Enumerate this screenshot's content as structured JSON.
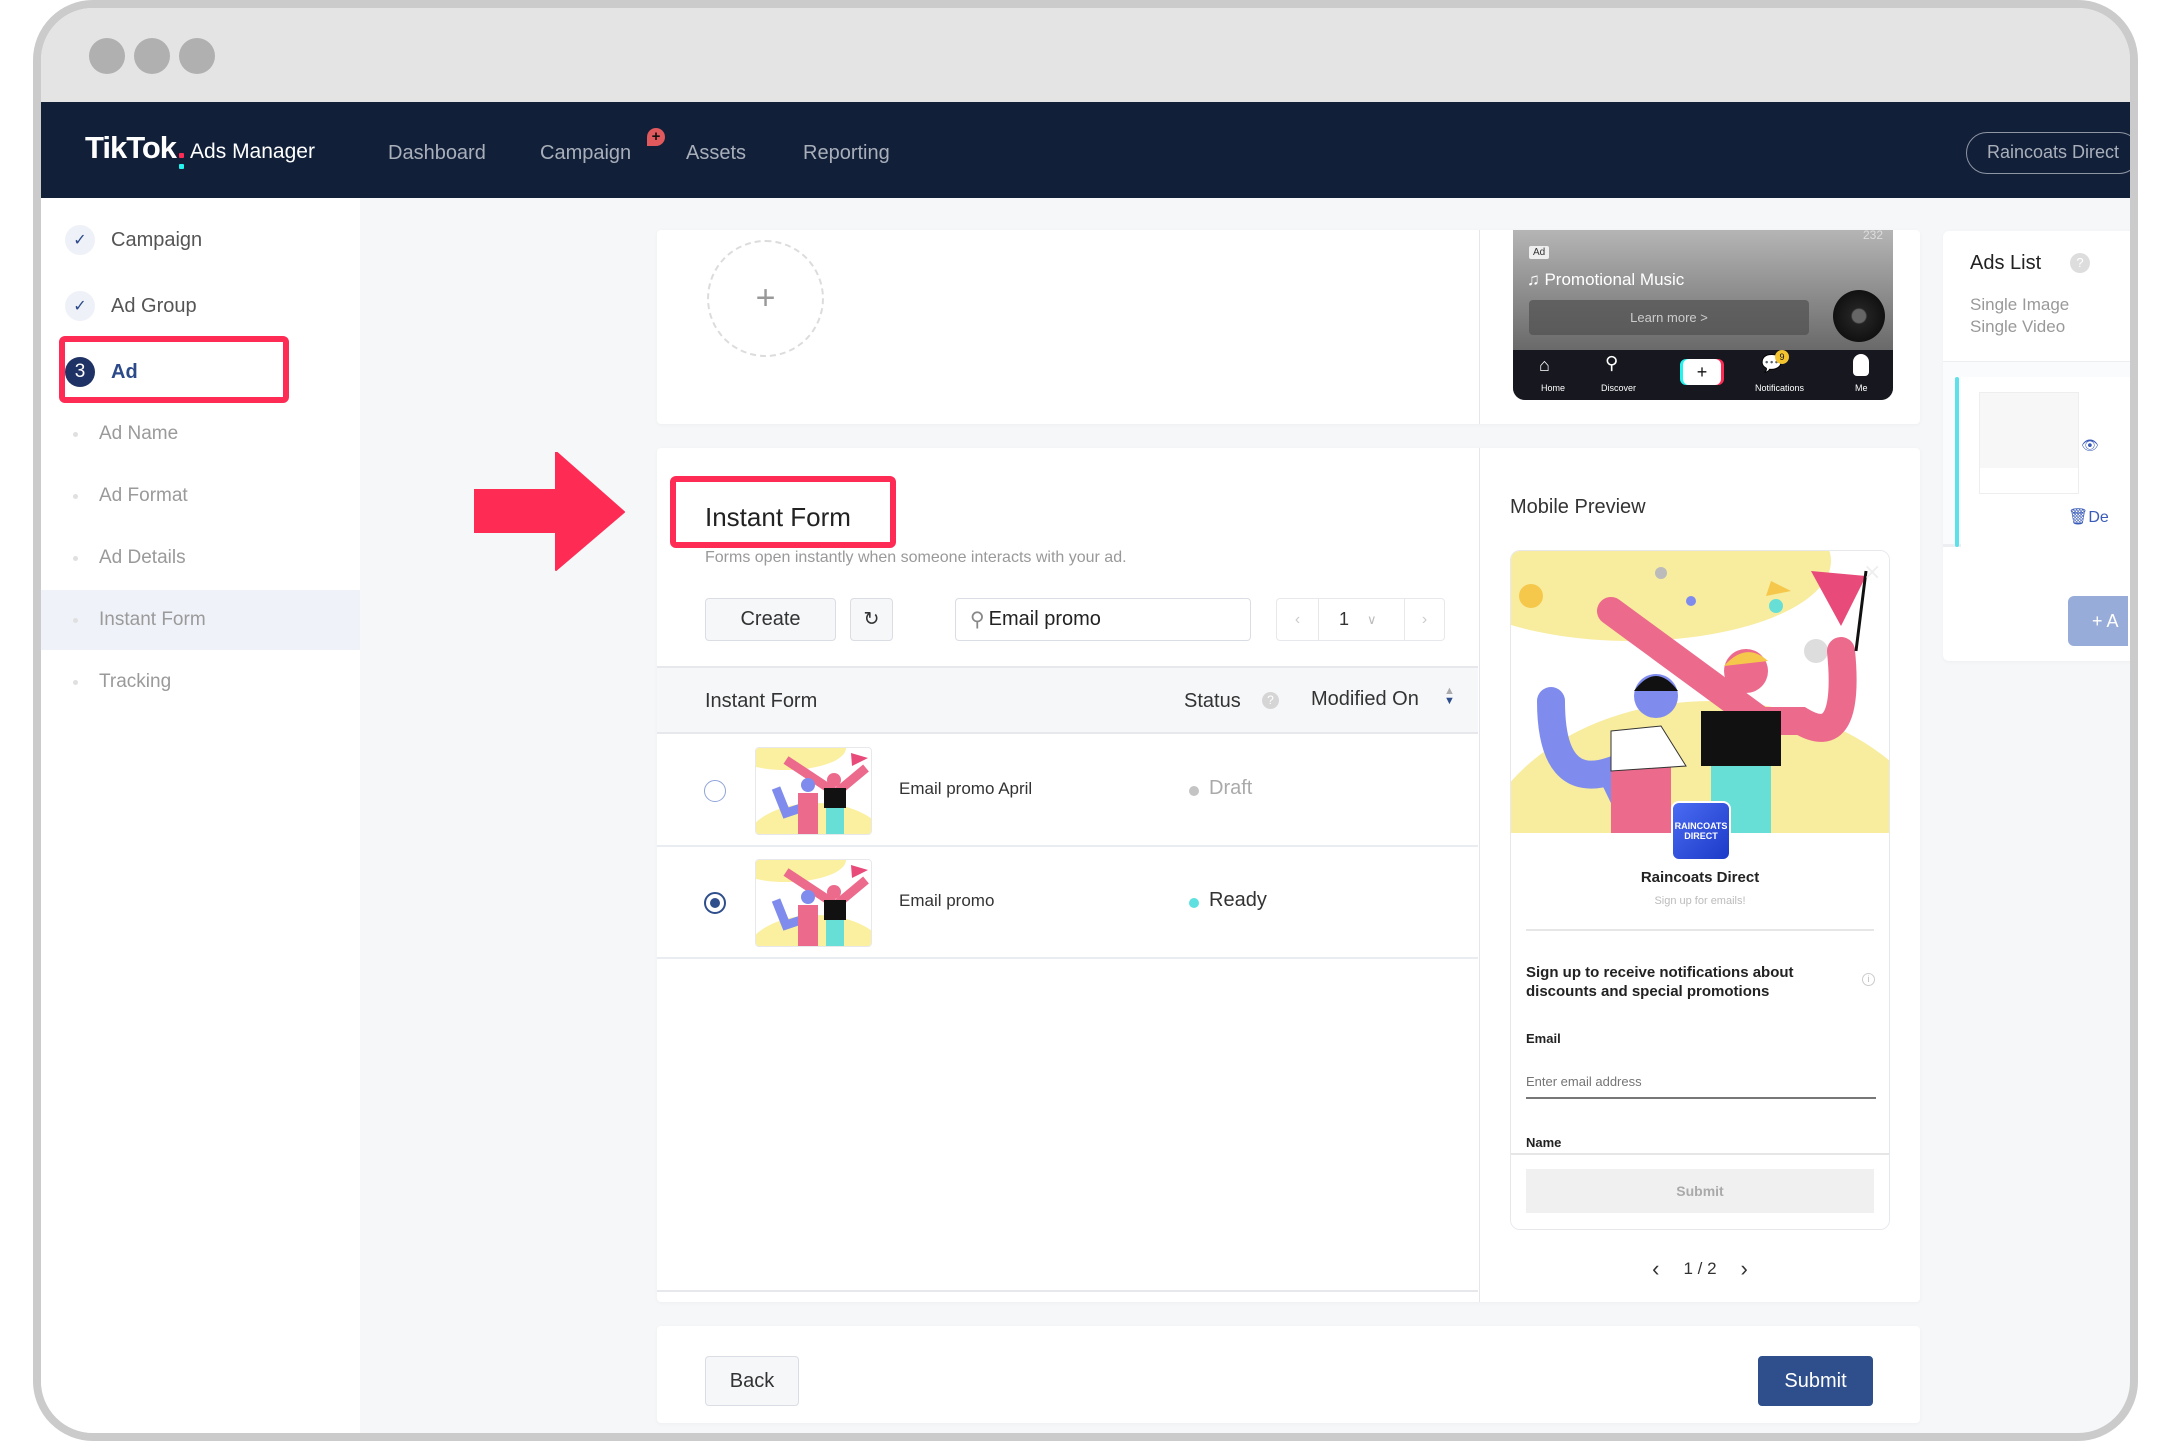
{
  "window": {
    "traffic_lights": 3
  },
  "topnav": {
    "logo_brand": "TikTok",
    "logo_product": "Ads Manager",
    "items": [
      "Dashboard",
      "Campaign",
      "Assets",
      "Reporting"
    ],
    "campaign_badge": "+",
    "account": "Raincoats Direct"
  },
  "sidebar": {
    "steps": [
      {
        "label": "Campaign",
        "state": "done",
        "marker": "✓"
      },
      {
        "label": "Ad Group",
        "state": "done",
        "marker": "✓"
      },
      {
        "label": "Ad",
        "state": "active",
        "marker": "3"
      }
    ],
    "substeps": [
      "Ad Name",
      "Ad Format",
      "Ad Details",
      "Instant Form",
      "Tracking"
    ],
    "selected_substep": "Instant Form"
  },
  "top_card": {
    "add_icon": "+",
    "phone": {
      "count": "232",
      "ad_badge": "Ad",
      "music": "♫ Promotional Music",
      "cta": "Learn more >",
      "tabs": [
        "Home",
        "Discover",
        "+",
        "Notifications",
        "Me"
      ],
      "notif_count": "9"
    }
  },
  "instant_form": {
    "title": "Instant Form",
    "description": "Forms open instantly when someone interacts with your ad.",
    "create_label": "Create",
    "refresh_icon": "↻",
    "search_value": "Email promo",
    "search_icon": "⚲",
    "page": "1",
    "columns": [
      "Instant Form",
      "Status",
      "Modified On"
    ],
    "rows": [
      {
        "name": "Email promo April",
        "status": "Draft",
        "status_color": "#c4c4c4",
        "selected": false
      },
      {
        "name": "Email promo",
        "status": "Ready",
        "status_color": "#5ee0e0",
        "selected": true
      }
    ]
  },
  "mobile_preview": {
    "title": "Mobile Preview",
    "brand": "Raincoats Direct",
    "logo_text": "RAINCOATS DIRECT",
    "tagline": "Sign up for emails!",
    "headline": "Sign up to receive notifications about discounts and special promotions",
    "email_label": "Email",
    "email_placeholder": "Enter email address",
    "name_label": "Name",
    "submit": "Submit",
    "pager": "1 / 2"
  },
  "ads_list": {
    "title": "Ads List",
    "types": [
      "Single Image",
      "Single Video"
    ],
    "delete_label": "De",
    "add_label": "+ A"
  },
  "footer": {
    "back": "Back",
    "submit": "Submit"
  },
  "colors": {
    "nav_bg": "#111f39",
    "accent": "#2f4f8c",
    "highlight": "#fe2c55",
    "ready": "#5ee0e0"
  }
}
